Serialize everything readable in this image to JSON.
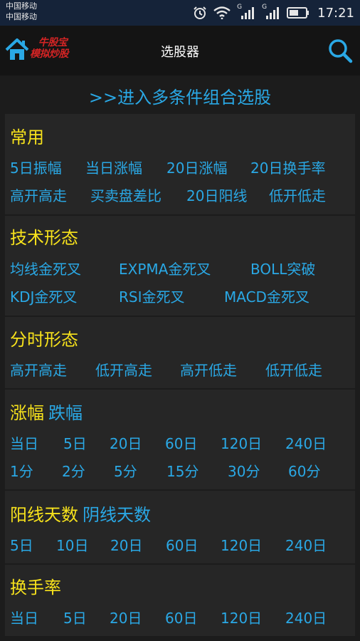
{
  "status_bar": {
    "carrier_1": "中国移动",
    "carrier_2": "中国移动",
    "signal_1_label": "G",
    "signal_2_label": "G",
    "time": "17:21",
    "icons": [
      "alarm-icon",
      "wifi-icon",
      "signal-icon",
      "signal-icon",
      "battery-icon"
    ]
  },
  "app_bar": {
    "logo_line1": "牛股宝",
    "logo_line2": "模拟炒股",
    "title": "选股器",
    "icons": [
      "home-icon",
      "search-icon"
    ]
  },
  "entry_link": ">>进入多条件组合选股",
  "sections": [
    {
      "title": "常用",
      "options": [
        "5日振幅",
        "当日涨幅",
        "20日涨幅",
        "20日换手率",
        "高开高走",
        "买卖盘差比",
        "20日阳线",
        "低开低走"
      ]
    },
    {
      "title": "技术形态",
      "options": [
        "均线金死叉",
        "EXPMA金死叉",
        "BOLL突破",
        "KDJ金死叉",
        "RSI金死叉",
        "MACD金死叉"
      ]
    },
    {
      "title": "分时形态",
      "options": [
        "高开高走",
        "低开高走",
        "高开低走",
        "低开低走"
      ]
    },
    {
      "title": "涨幅",
      "title_alt": "跌幅",
      "options": [
        "当日",
        "5日",
        "20日",
        "60日",
        "120日",
        "240日",
        "1分",
        "2分",
        "5分",
        "15分",
        "30分",
        "60分"
      ]
    },
    {
      "title": "阳线天数",
      "title_alt": "阴线天数",
      "options": [
        "5日",
        "10日",
        "20日",
        "60日",
        "120日",
        "240日"
      ]
    },
    {
      "title": "换手率",
      "options": [
        "当日",
        "5日",
        "20日",
        "60日",
        "120日",
        "240日"
      ]
    }
  ],
  "colors": {
    "background": "#1c1c1c",
    "card": "#262626",
    "status_bar": "#152339",
    "app_bar": "#141414",
    "accent_blue": "#2aa8e5",
    "section_yellow": "#f7e21c",
    "logo_red": "#d42424"
  }
}
